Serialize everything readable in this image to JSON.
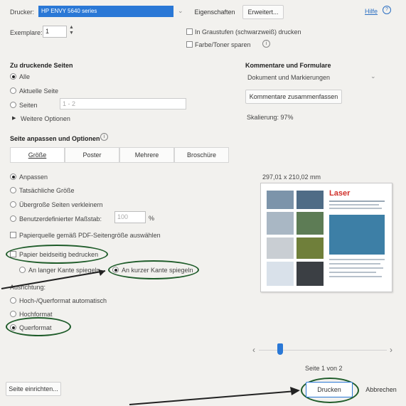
{
  "printer": {
    "label": "Drucker:",
    "selected": "HP ENVY 5640 series",
    "properties_button": "Eigenschaften",
    "advanced_button": "Erweitert...",
    "help_link": "Hilfe"
  },
  "copies": {
    "label": "Exemplare:",
    "value": "1",
    "grayscale_label": "In Graustufen (schwarzweiß) drucken",
    "save_toner_label": "Farbe/Toner sparen"
  },
  "pages_to_print": {
    "heading": "Zu druckende Seiten",
    "options": [
      "Alle",
      "Aktuelle Seite",
      "Seiten"
    ],
    "selected": "Alle",
    "pages_value": "1 - 2",
    "more_options": "Weitere Optionen"
  },
  "comments": {
    "heading": "Kommentare und Formulare",
    "select_value": "Dokument und Markierungen",
    "summarize_button": "Kommentare zusammenfassen",
    "scale_text": "Skalierung: 97%"
  },
  "page_options": {
    "heading": "Seite anpassen und Optionen",
    "tabs": [
      "Größe",
      "Poster",
      "Mehrere",
      "Broschüre"
    ],
    "active_tab": "Größe",
    "size_options": [
      "Anpassen",
      "Tatsächliche Größe",
      "Übergroße Seiten verkleinern",
      "Benutzerdefinierter Maßstab:"
    ],
    "size_selected": "Anpassen",
    "custom_scale_value": "100",
    "custom_scale_unit": "%",
    "paper_source_label": "Papierquelle gemäß PDF-Seitengröße auswählen",
    "duplex_label": "Papier beidseitig bedrucken",
    "flip_long": "An langer Kante spiegeln",
    "flip_short": "An kurzer Kante spiegeln",
    "flip_selected": "An kurzer Kante spiegeln",
    "orientation_label": "Ausrichtung:",
    "orientation_options": [
      "Hoch-/Querformat automatisch",
      "Hochformat",
      "Querformat"
    ],
    "orientation_selected": "Querformat"
  },
  "preview": {
    "dimensions": "297,01 x 210,02 mm",
    "brand_text": "Laser",
    "page_counter": "Seite 1 von 2",
    "nav_prev": "‹",
    "nav_next": "›"
  },
  "footer": {
    "page_setup_button": "Seite einrichten...",
    "print_button": "Drucken",
    "cancel_button": "Abbrechen"
  },
  "colors": {
    "selection_blue": "#2a78d6",
    "link_blue": "#2b6fc2",
    "marker_green": "#1f5c2a",
    "brand_red": "#d0302a"
  }
}
